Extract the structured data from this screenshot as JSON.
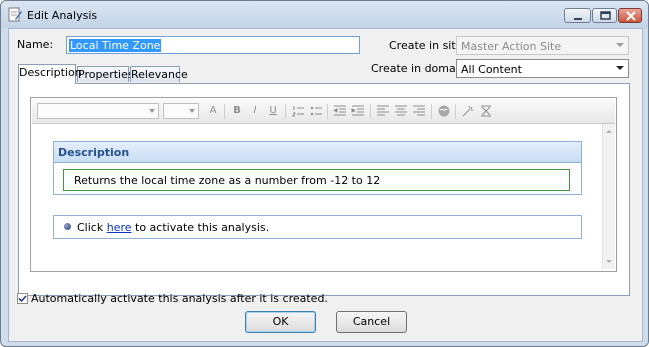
{
  "window": {
    "title": "Edit Analysis",
    "controls": {
      "minimize_icon": "minimize-icon",
      "maximize_icon": "maximize-icon",
      "close_icon": "close-icon"
    }
  },
  "form": {
    "name_label": "Name:",
    "name_value": "Local Time Zone",
    "create_in_site_label": "Create in site:",
    "create_in_site_value": "Master Action Site",
    "create_in_domain_label": "Create in domain:",
    "create_in_domain_value": "All Content"
  },
  "tabs": [
    {
      "label": "Description",
      "active": true
    },
    {
      "label": "Properties",
      "active": false
    },
    {
      "label": "Relevance",
      "active": false
    }
  ],
  "editor": {
    "toolbar_icons": [
      "font-family-select",
      "font-size-select",
      "font-color-icon",
      "bold-icon",
      "italic-icon",
      "underline-icon",
      "numbered-list-icon",
      "bullet-list-icon",
      "outdent-icon",
      "indent-icon",
      "align-left-icon",
      "align-center-icon",
      "align-right-icon",
      "insert-link-icon",
      "clean-format-icon",
      "html-source-icon"
    ],
    "description_heading": "Description",
    "description_text": "Returns the local time zone as a number from -12 to 12",
    "activate_prefix": "Click",
    "activate_link": "here",
    "activate_suffix": "to activate this analysis."
  },
  "footer": {
    "auto_activate_label": "Automatically activate this analysis after it is created.",
    "auto_activate_checked": true,
    "ok_label": "OK",
    "cancel_label": "Cancel"
  },
  "colors": {
    "titlebar": "#cfdceb",
    "section_header": "#c9ddf3",
    "section_title": "#23518c",
    "link": "#0b35c6",
    "focus_border": "#3f9a3f",
    "selection": "#3399ff"
  }
}
